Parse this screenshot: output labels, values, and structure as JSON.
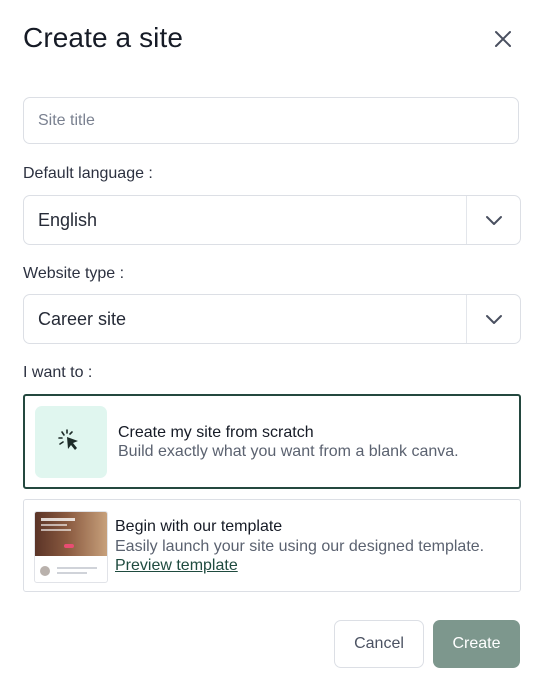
{
  "dialog": {
    "title": "Create a site",
    "close_icon": "close-icon"
  },
  "site_title": {
    "value": "",
    "placeholder": "Site title"
  },
  "language": {
    "label": "Default language :",
    "selected": "English",
    "icon": "chevron-down-icon"
  },
  "website_type": {
    "label": "Website type :",
    "selected": "Career site",
    "icon": "chevron-down-icon"
  },
  "intent": {
    "label": "I want to :",
    "options": [
      {
        "title": "Create my site from scratch",
        "description": "Build exactly what you want from a blank canva.",
        "icon": "cursor-click-icon",
        "selected": true
      },
      {
        "title": "Begin with our template",
        "description": "Easily launch your site using our designed template.",
        "link": "Preview template",
        "icon": "template-thumbnail",
        "selected": false
      }
    ]
  },
  "actions": {
    "cancel": "Cancel",
    "create": "Create"
  },
  "colors": {
    "accent": "#24483f",
    "tile_bg": "#e0f6ef",
    "create_button": "#7d978d"
  }
}
